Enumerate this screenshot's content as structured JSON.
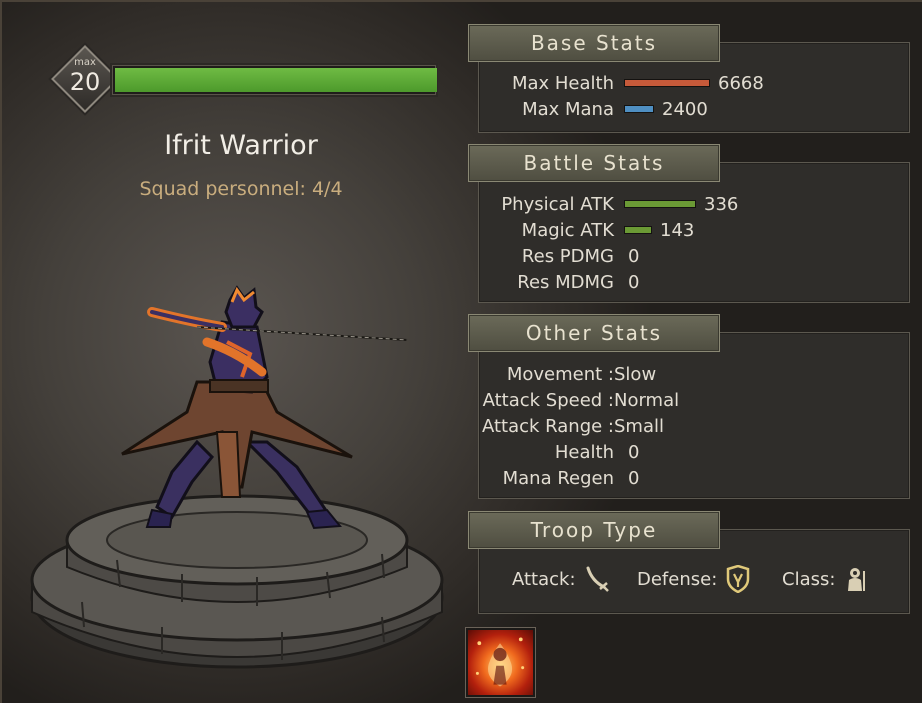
{
  "unit": {
    "level_cap_label": "max",
    "level": "20",
    "level_progress": 1.0,
    "name": "Ifrit Warrior",
    "squad_label": "Squad personnel: 4/4"
  },
  "base_stats": {
    "title": "Base Stats",
    "rows": [
      {
        "label": "Max Health",
        "value": "6668",
        "bar_color": "#c65a3a"
      },
      {
        "label": "Max Mana",
        "value": "2400",
        "bar_color": "#4f8fc2"
      }
    ]
  },
  "battle_stats": {
    "title": "Battle Stats",
    "rows": [
      {
        "label": "Physical ATK",
        "value": "336",
        "bar_color": "#6b9a35"
      },
      {
        "label": "Magic ATK",
        "value": "143",
        "bar_color": "#6b9a35"
      },
      {
        "label": "Res PDMG",
        "value": "0"
      },
      {
        "label": "Res MDMG",
        "value": "0"
      }
    ]
  },
  "other_stats": {
    "title": "Other Stats",
    "rows": [
      {
        "label": "Movement :",
        "value": "Slow"
      },
      {
        "label": "Attack Speed :",
        "value": "Normal"
      },
      {
        "label": "Attack Range :",
        "value": "Small"
      },
      {
        "label": "Health",
        "value": "0"
      },
      {
        "label": "Mana Regen",
        "value": "0"
      }
    ]
  },
  "troop_type": {
    "title": "Troop Type",
    "attack_label": "Attack:",
    "defense_label": "Defense:",
    "class_label": "Class:",
    "attack_icon": "curved-sword-icon",
    "defense_icon": "shield-icon",
    "class_icon": "soldier-icon"
  },
  "skill": {
    "icon": "fire-burst-icon"
  },
  "colors": {
    "level_bar": "#5aa534",
    "squad_text": "#c9ad7e",
    "panel_header": "#5e5d4d"
  }
}
